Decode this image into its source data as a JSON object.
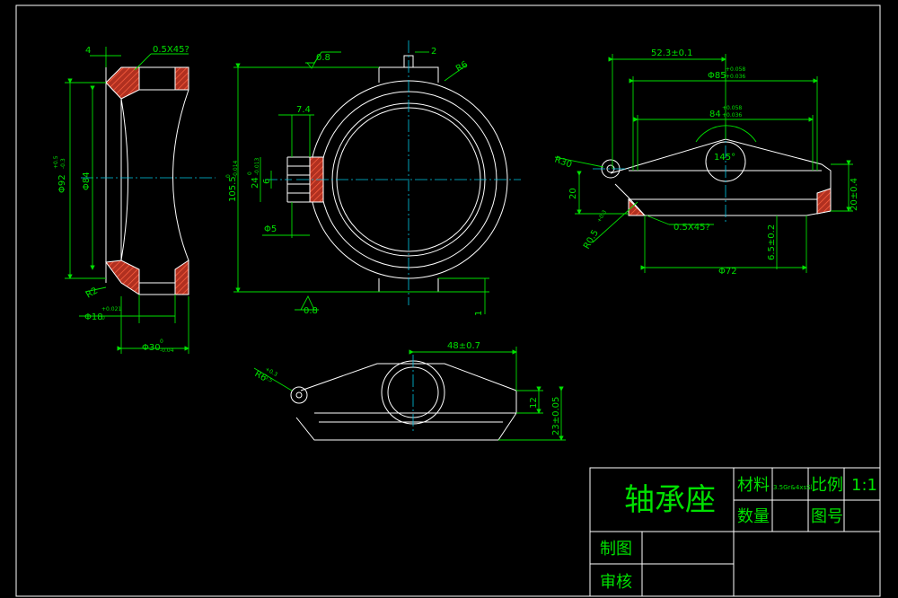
{
  "title_block": {
    "part_name": "轴承座",
    "material_label": "材料",
    "material_value": "3.5Gr&4xsSl",
    "scale_label": "比例",
    "scale_value": "1:1",
    "quantity_label": "数量",
    "drawing_no_label": "图号",
    "drawn_by_label": "制图",
    "checked_by_label": "审核"
  },
  "view_left": {
    "dim_4": "4",
    "chamfer": "0.5X45?",
    "dia_92": "Φ92",
    "dia_92_upper": "+0.5",
    "dia_92_lower": "-0.3",
    "dia_84": "Φ84",
    "r2": "R2",
    "dia_18": "Φ18",
    "dia_18_upper": "+0.021",
    "dia_18_lower": "0",
    "dia_30": "Φ30",
    "dia_30_upper": "0",
    "dia_30_lower": "-0.04"
  },
  "view_front": {
    "rough_top": "0.8",
    "dim_2": "2",
    "r6": "R6",
    "dim_7_4": "7.4",
    "dim_105": "105.5",
    "dim_105_upper": "0",
    "dim_105_lower": "-0.014",
    "dim_24": "24",
    "dim_24_upper": "0",
    "dim_24_lower": "-0.013",
    "dim_6": "6",
    "dia_5": "Φ5",
    "rough_bottom": "0.8",
    "dim_1": "1"
  },
  "view_right": {
    "dim_52": "52.3±0.1",
    "dia_85": "Φ85",
    "dia_85_upper": "+0.058",
    "dia_85_lower": "+0.036",
    "dim_84": "84",
    "dim_84_upper": "+0.058",
    "dim_84_lower": "+0.036",
    "r30": "R30",
    "angle": "145°",
    "dim_20": "20",
    "dim_20_tol": "20±0.4",
    "r0_5": "R0.5",
    "r0_5_tol": "+0.3",
    "chamfer": "0.5X45?",
    "dim_6_5": "6.5±0.2",
    "dia_72": "Φ72"
  },
  "view_bottom": {
    "dim_48": "48±0.7",
    "r6": "R6",
    "r6_upper": "+0.3",
    "r6_lower": "-0.5",
    "dim_12": "12",
    "dim_23": "23±0.05"
  }
}
